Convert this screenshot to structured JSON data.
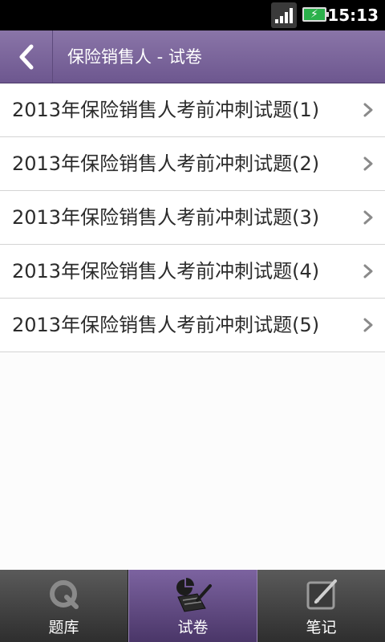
{
  "status_bar": {
    "time": "15:13",
    "battery_color": "#2bb14b"
  },
  "header": {
    "title": "保险销售人 - 试卷",
    "background": "#7a649a"
  },
  "list": {
    "items": [
      {
        "label": "2013年保险销售人考前冲刺试题(1)"
      },
      {
        "label": "2013年保险销售人考前冲刺试题(2)"
      },
      {
        "label": "2013年保险销售人考前冲刺试题(3)"
      },
      {
        "label": "2013年保险销售人考前冲刺试题(4)"
      },
      {
        "label": "2013年保险销售人考前冲刺试题(5)"
      }
    ]
  },
  "tabs": [
    {
      "label": "题库",
      "icon": "question-bank-icon",
      "active": false
    },
    {
      "label": "试卷",
      "icon": "exam-paper-icon",
      "active": true
    },
    {
      "label": "笔记",
      "icon": "notes-icon",
      "active": false
    }
  ]
}
